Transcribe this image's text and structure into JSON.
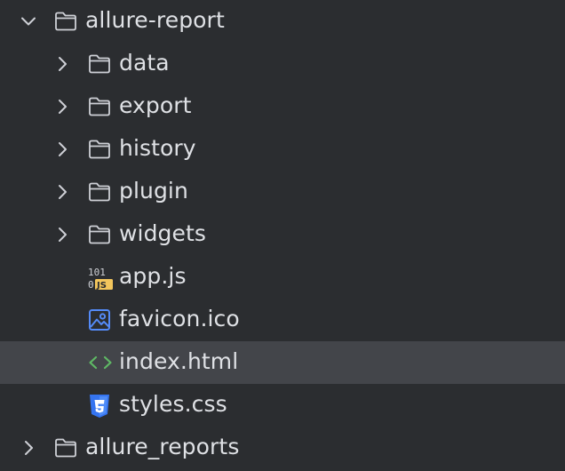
{
  "tree": {
    "root_folder": {
      "label": "allure-report",
      "expanded": true,
      "icon": "folder-icon"
    },
    "children": [
      {
        "label": "data",
        "type": "folder",
        "icon": "folder-icon",
        "expanded": false
      },
      {
        "label": "export",
        "type": "folder",
        "icon": "folder-icon",
        "expanded": false
      },
      {
        "label": "history",
        "type": "folder",
        "icon": "folder-icon",
        "expanded": false
      },
      {
        "label": "plugin",
        "type": "folder",
        "icon": "folder-icon",
        "expanded": false
      },
      {
        "label": "widgets",
        "type": "folder",
        "icon": "folder-icon",
        "expanded": false
      },
      {
        "label": "app.js",
        "type": "file",
        "icon": "javascript-file-icon"
      },
      {
        "label": "favicon.ico",
        "type": "file",
        "icon": "image-file-icon"
      },
      {
        "label": "index.html",
        "type": "file",
        "icon": "html-file-icon",
        "selected": true
      },
      {
        "label": "styles.css",
        "type": "file",
        "icon": "css-file-icon"
      }
    ],
    "sibling_folder": {
      "label": "allure_reports",
      "expanded": false,
      "icon": "folder-icon"
    },
    "js_icon_text": {
      "top": "101",
      "bottom": "0",
      "badge": "JS"
    }
  },
  "colors": {
    "background": "#2b2d30",
    "selected_row": "#43454a",
    "text": "#dfe1e5",
    "chevron": "#ced0d6",
    "folder_stroke": "#ced0d6",
    "js_badge": "#f2c55c",
    "image_icon": "#548af7",
    "html_icon": "#5fb865",
    "css_icon": "#3574f0"
  }
}
